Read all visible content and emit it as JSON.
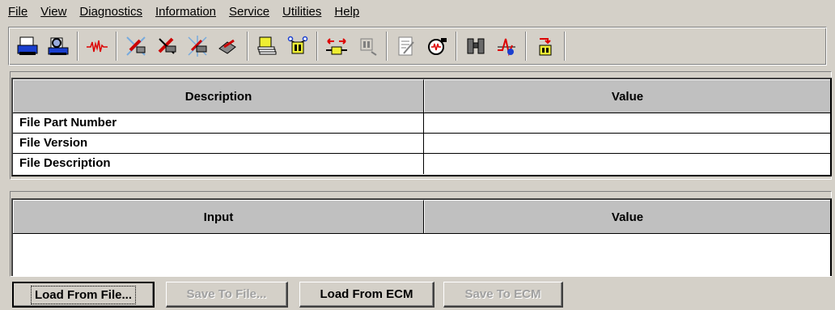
{
  "menu": [
    {
      "label": "File"
    },
    {
      "label": "View"
    },
    {
      "label": "Diagnostics"
    },
    {
      "label": "Information"
    },
    {
      "label": "Service"
    },
    {
      "label": "Utilities"
    },
    {
      "label": "Help"
    }
  ],
  "toolbar": {
    "icons": [
      "print-icon",
      "print-preview-icon",
      "waveform-icon",
      "diag-tool-1-icon",
      "diag-tool-2-icon",
      "diag-tool-3-icon",
      "diag-tool-4-icon",
      "documents-icon",
      "ecm-icon",
      "connection-icon",
      "ecm-disabled-icon",
      "edit-icon",
      "sensor-icon",
      "binoculars-icon",
      "graph-icon",
      "download-icon"
    ]
  },
  "file_table": {
    "headers": [
      "Description",
      "Value"
    ],
    "rows": [
      {
        "description": "File Part Number",
        "value": ""
      },
      {
        "description": "File Version",
        "value": ""
      },
      {
        "description": "File Description",
        "value": ""
      }
    ]
  },
  "input_table": {
    "headers": [
      "Input",
      "Value"
    ]
  },
  "buttons": {
    "load_from_file": "Load From File...",
    "save_to_file": "Save To File...",
    "load_from_ecm": "Load From ECM",
    "save_to_ecm": "Save To ECM"
  },
  "colors": {
    "face": "#d4d0c8",
    "header": "#c0c0c0",
    "disabled_text": "#a0a0a0"
  }
}
